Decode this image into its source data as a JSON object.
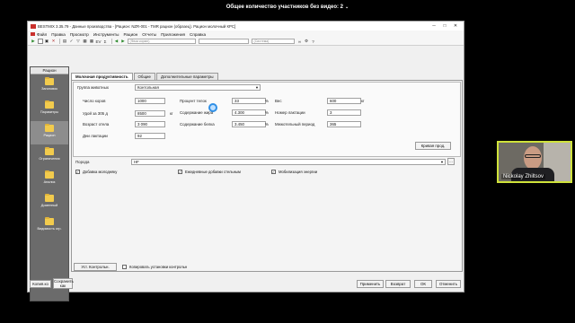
{
  "meeting": {
    "participants_label": "Общее количество участников без видео: 2"
  },
  "window": {
    "title": "BESTMIX 3.35.79 - Данные производства - [Рацион: NZR-001 - TMR рацион (образец). Рацион молочный КРС]",
    "minimize": "─",
    "maximize": "□",
    "close": "✕"
  },
  "menu": [
    "Файл",
    "Правка",
    "Просмотр",
    "Инструменты",
    "Рацион",
    "Отчеты",
    "Приложения",
    "Справка"
  ],
  "toolbar": {
    "ev_label": "EV",
    "sum_label": "Σ",
    "select1": "(Фаза кормл)",
    "select2": "",
    "select3": "(Система)"
  },
  "sidebar": {
    "header": "Рацион",
    "items": [
      {
        "label": "Заголовок"
      },
      {
        "label": "Параметры"
      },
      {
        "label": "Рацион"
      },
      {
        "label": "Ограничения"
      },
      {
        "label": "Анализ"
      },
      {
        "label": "Доменный"
      },
      {
        "label": "Видимость огр."
      }
    ]
  },
  "tabs": [
    "Молочная продуктивность",
    "Общие",
    "Дополнительные параметры"
  ],
  "form": {
    "group_label": "Группа животных",
    "group_value": "Контольная",
    "cows_label": "Число коров",
    "cows_value": "1000",
    "yield_label": "Удой за 305 д",
    "yield_value": "8500",
    "yield_unit": "кг",
    "age_label": "Возраст отела",
    "age_value": "3 090",
    "lact_days_label": "Дни лактации",
    "lact_days_value": "92",
    "fat_pct_label": "Процент телок",
    "fat_pct_value": "33",
    "fat_pct_unit": "%",
    "fat_label": "Содержание жира",
    "fat_value": "4.300",
    "fat_unit": "%",
    "protein_label": "Содержание белка",
    "protein_value": "3.450",
    "protein_unit": "%",
    "weight_label": "Вес",
    "weight_value": "600",
    "weight_unit": "кг",
    "lact_no_label": "Номер лактации",
    "lact_no_value": "3",
    "interval_label": "Межотельный период",
    "interval_value": "365",
    "curve_button": "Кривая прод.",
    "breed_label": "Порода",
    "breed_value": "HF",
    "chk1_label": "Добавка молодняку",
    "chk2_label": "Ежедневные добавки стельным",
    "chk3_label": "Мобилизация энергии"
  },
  "bottom": {
    "set_control_button": "Уст. Контрольн.",
    "copy_check_label": "Копировать установки контрольн",
    "left_btn1": "Копия.ко",
    "left_btn2": "Сохранить как",
    "apply": "Применить",
    "back": "Возврат",
    "ok": "ОК",
    "cancel": "Отменить"
  },
  "video": {
    "name": "Nickolay Zhiltsov"
  }
}
